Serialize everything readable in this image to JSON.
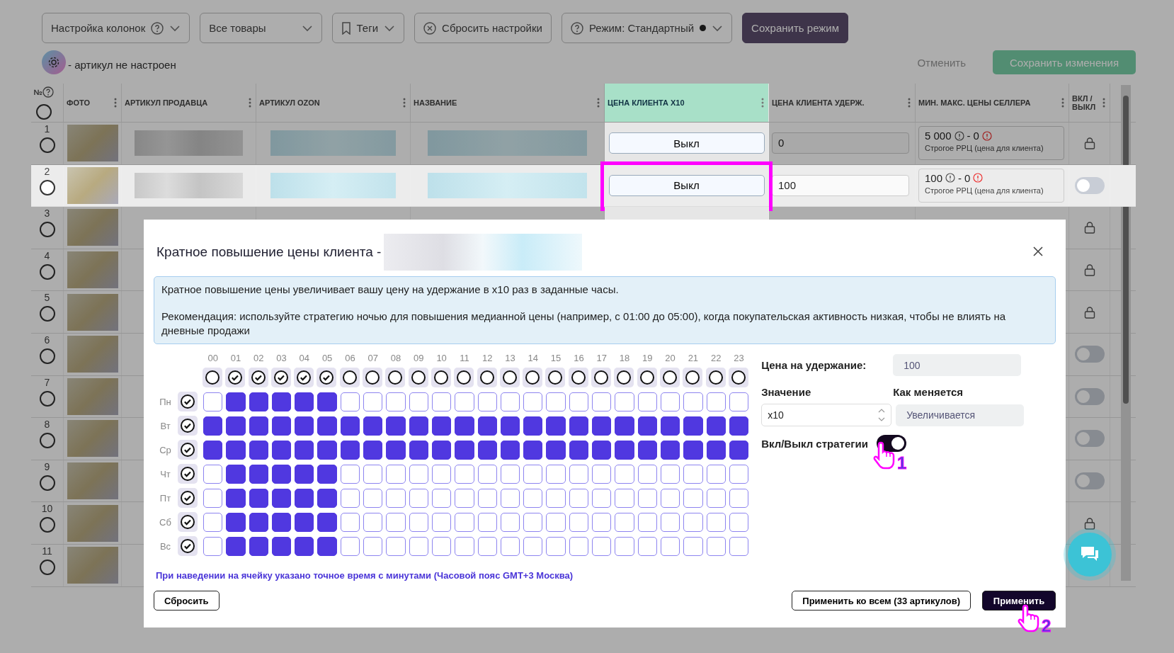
{
  "toolbar": [
    {
      "kind": "columns",
      "label": "Настройка колонок"
    },
    {
      "kind": "dropdown",
      "label": "Все товары"
    },
    {
      "kind": "tags",
      "label": "Теги"
    },
    {
      "kind": "reset",
      "label": "Сбросить настройки"
    },
    {
      "kind": "mode",
      "label": "Режим: Стандартный"
    },
    {
      "kind": "primary",
      "label": "Сохранить режим"
    }
  ],
  "legend": {
    "text": "- артикул не настроен"
  },
  "actions": [
    {
      "kind": "link",
      "label": "Отменить"
    },
    {
      "kind": "primary",
      "label": "Сохранить изменения"
    }
  ],
  "table": {
    "all_checked": false,
    "columns": [
      {
        "label": "№",
        "kind": "number"
      },
      {
        "label": "ФОТО",
        "kind": "photo"
      },
      {
        "label": "АРТИКУЛ ПРОДАВЦА",
        "kind": "blur"
      },
      {
        "label": "АРТИКУЛ OZON",
        "kind": "blur"
      },
      {
        "label": "НАЗВАНИЕ",
        "kind": "blur"
      },
      {
        "label": "ЦЕНА КЛИЕНТА X10",
        "kind": "x10",
        "selected": true
      },
      {
        "label": "ЦЕНА КЛИЕНТА УДЕРЖ.",
        "kind": "hold"
      },
      {
        "label": "МИН. МАКС. ЦЕНЫ СЕЛЛЕРА",
        "kind": "minmax"
      },
      {
        "label": "ВКЛ / ВЫКЛ",
        "kind": "switch"
      }
    ],
    "rows": [
      {
        "number": "1",
        "selected": false,
        "checked": false,
        "x10": "Выкл",
        "hold": "0",
        "min": "5 000",
        "sep": "-",
        "max": "0",
        "rrc": "Строгое РРЦ (цена для клиента)",
        "kind": "lock"
      },
      {
        "number": "2",
        "selected": true,
        "checked": false,
        "x10": "Выкл",
        "hold": "100",
        "min": "100",
        "sep": "-",
        "max": "0",
        "rrc": "Строгое РРЦ (цена для клиента)",
        "kind": "toggle",
        "on": false
      },
      {
        "number": "3",
        "selected": false,
        "checked": false,
        "kind": "lock"
      },
      {
        "number": "4",
        "selected": false,
        "checked": false,
        "kind": "lock"
      },
      {
        "number": "5",
        "selected": false,
        "checked": false,
        "kind": "lock"
      },
      {
        "number": "6",
        "selected": false,
        "checked": false,
        "kind": "toggle",
        "on": false
      },
      {
        "number": "7",
        "selected": false,
        "checked": false,
        "kind": "toggle",
        "on": false
      },
      {
        "number": "8",
        "selected": false,
        "checked": false,
        "kind": "toggle",
        "on": false
      },
      {
        "number": "9",
        "selected": false,
        "checked": false,
        "kind": "toggle",
        "on": false
      },
      {
        "number": "10",
        "selected": false,
        "checked": false,
        "kind": "lock"
      },
      {
        "number": "11",
        "selected": false,
        "checked": false,
        "kind": "none"
      }
    ]
  },
  "modal": {
    "title": "Кратное повышение цены клиента -",
    "info": [
      "Кратное повышение цены увеличивает вашу цену на удержание в x10 раз в заданные часы.",
      "Рекомендация: используйте стратегию ночью для повышения медианной цены (например, с 01:00 до 05:00), когда покупательская активность низкая, чтобы не влиять на дневные продажи"
    ],
    "hours": [
      {
        "label": "00",
        "checked": false
      },
      {
        "label": "01",
        "checked": true
      },
      {
        "label": "02",
        "checked": true
      },
      {
        "label": "03",
        "checked": true
      },
      {
        "label": "04",
        "checked": true
      },
      {
        "label": "05",
        "checked": true
      },
      {
        "label": "06",
        "checked": false
      },
      {
        "label": "07",
        "checked": false
      },
      {
        "label": "08",
        "checked": false
      },
      {
        "label": "09",
        "checked": false
      },
      {
        "label": "10",
        "checked": false
      },
      {
        "label": "11",
        "checked": false
      },
      {
        "label": "12",
        "checked": false
      },
      {
        "label": "13",
        "checked": false
      },
      {
        "label": "14",
        "checked": false
      },
      {
        "label": "15",
        "checked": false
      },
      {
        "label": "16",
        "checked": false
      },
      {
        "label": "17",
        "checked": false
      },
      {
        "label": "18",
        "checked": false
      },
      {
        "label": "19",
        "checked": false
      },
      {
        "label": "20",
        "checked": false
      },
      {
        "label": "21",
        "checked": false
      },
      {
        "label": "22",
        "checked": false
      },
      {
        "label": "23",
        "checked": false
      }
    ],
    "days": [
      {
        "label": "Пн",
        "checked": true,
        "cells": [
          false,
          true,
          true,
          true,
          true,
          true,
          false,
          false,
          false,
          false,
          false,
          false,
          false,
          false,
          false,
          false,
          false,
          false,
          false,
          false,
          false,
          false,
          false,
          false
        ]
      },
      {
        "label": "Вт",
        "checked": true,
        "cells": [
          true,
          true,
          true,
          true,
          true,
          true,
          true,
          true,
          true,
          true,
          true,
          true,
          true,
          true,
          true,
          true,
          true,
          true,
          true,
          true,
          true,
          true,
          true,
          true
        ]
      },
      {
        "label": "Ср",
        "checked": true,
        "cells": [
          true,
          true,
          true,
          true,
          true,
          true,
          true,
          true,
          true,
          true,
          true,
          true,
          true,
          true,
          true,
          true,
          true,
          true,
          true,
          true,
          true,
          true,
          true,
          true
        ]
      },
      {
        "label": "Чт",
        "checked": true,
        "cells": [
          false,
          true,
          true,
          true,
          true,
          true,
          false,
          false,
          false,
          false,
          false,
          false,
          false,
          false,
          false,
          false,
          false,
          false,
          false,
          false,
          false,
          false,
          false,
          false
        ]
      },
      {
        "label": "Пт",
        "checked": true,
        "cells": [
          false,
          true,
          true,
          true,
          true,
          true,
          false,
          false,
          false,
          false,
          false,
          false,
          false,
          false,
          false,
          false,
          false,
          false,
          false,
          false,
          false,
          false,
          false,
          false
        ]
      },
      {
        "label": "Сб",
        "checked": true,
        "cells": [
          false,
          true,
          true,
          true,
          true,
          true,
          false,
          false,
          false,
          false,
          false,
          false,
          false,
          false,
          false,
          false,
          false,
          false,
          false,
          false,
          false,
          false,
          false,
          false
        ]
      },
      {
        "label": "Вс",
        "checked": true,
        "cells": [
          false,
          true,
          true,
          true,
          true,
          true,
          false,
          false,
          false,
          false,
          false,
          false,
          false,
          false,
          false,
          false,
          false,
          false,
          false,
          false,
          false,
          false,
          false,
          false
        ]
      }
    ],
    "hold_label": "Цена на удержание:",
    "hold_value": "100",
    "value_label": "Значение",
    "value": "x10",
    "change_label": "Как меняется",
    "change_value": "Увеличивается",
    "toggle_label": "Вкл/Выкл стратегии",
    "toggle_on": true,
    "hint": "При наведении на ячейку указано точное время с минутами (Часовой пояс GMT+3 Москва)",
    "buttons": [
      {
        "kind": "outline",
        "label": "Сбросить"
      },
      {
        "kind": "outline",
        "label": "Применить ко всем (33 артикулов)"
      },
      {
        "kind": "dark",
        "label": "Применить"
      }
    ]
  },
  "annotations": [
    {
      "label": "1",
      "kind": "toggle"
    },
    {
      "label": "2",
      "kind": "apply"
    }
  ]
}
